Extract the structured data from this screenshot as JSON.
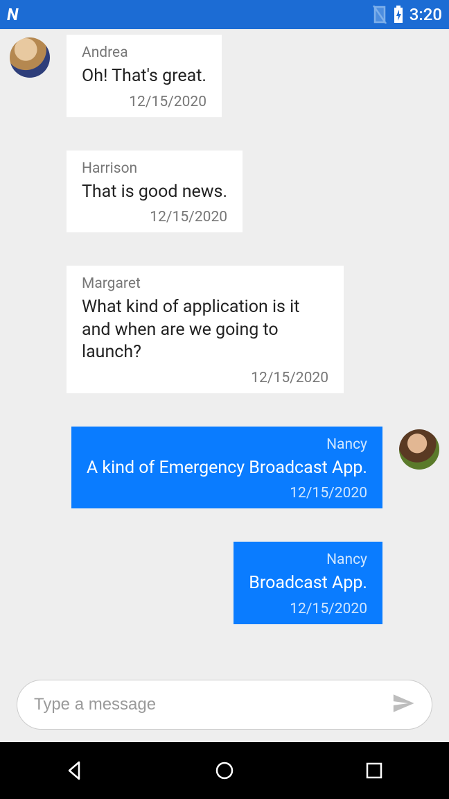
{
  "status_bar": {
    "time": "3:20"
  },
  "messages": [
    {
      "sender": "Andrea",
      "text": "Oh! That's great.",
      "timestamp": "12/15/2020",
      "outgoing": false,
      "show_avatar": true
    },
    {
      "sender": "Harrison",
      "text": "That is good news.",
      "timestamp": "12/15/2020",
      "outgoing": false,
      "show_avatar": false
    },
    {
      "sender": "Margaret",
      "text": "What kind of application is it and when are we going to launch?",
      "timestamp": "12/15/2020",
      "outgoing": false,
      "show_avatar": false
    },
    {
      "sender": "Nancy",
      "text": "A kind of Emergency Broadcast App.",
      "timestamp": "12/15/2020",
      "outgoing": true,
      "show_avatar": true
    },
    {
      "sender": "Nancy",
      "text": "Broadcast App.",
      "timestamp": "12/15/2020",
      "outgoing": true,
      "show_avatar": false
    }
  ],
  "composer": {
    "placeholder": "Type a message"
  }
}
